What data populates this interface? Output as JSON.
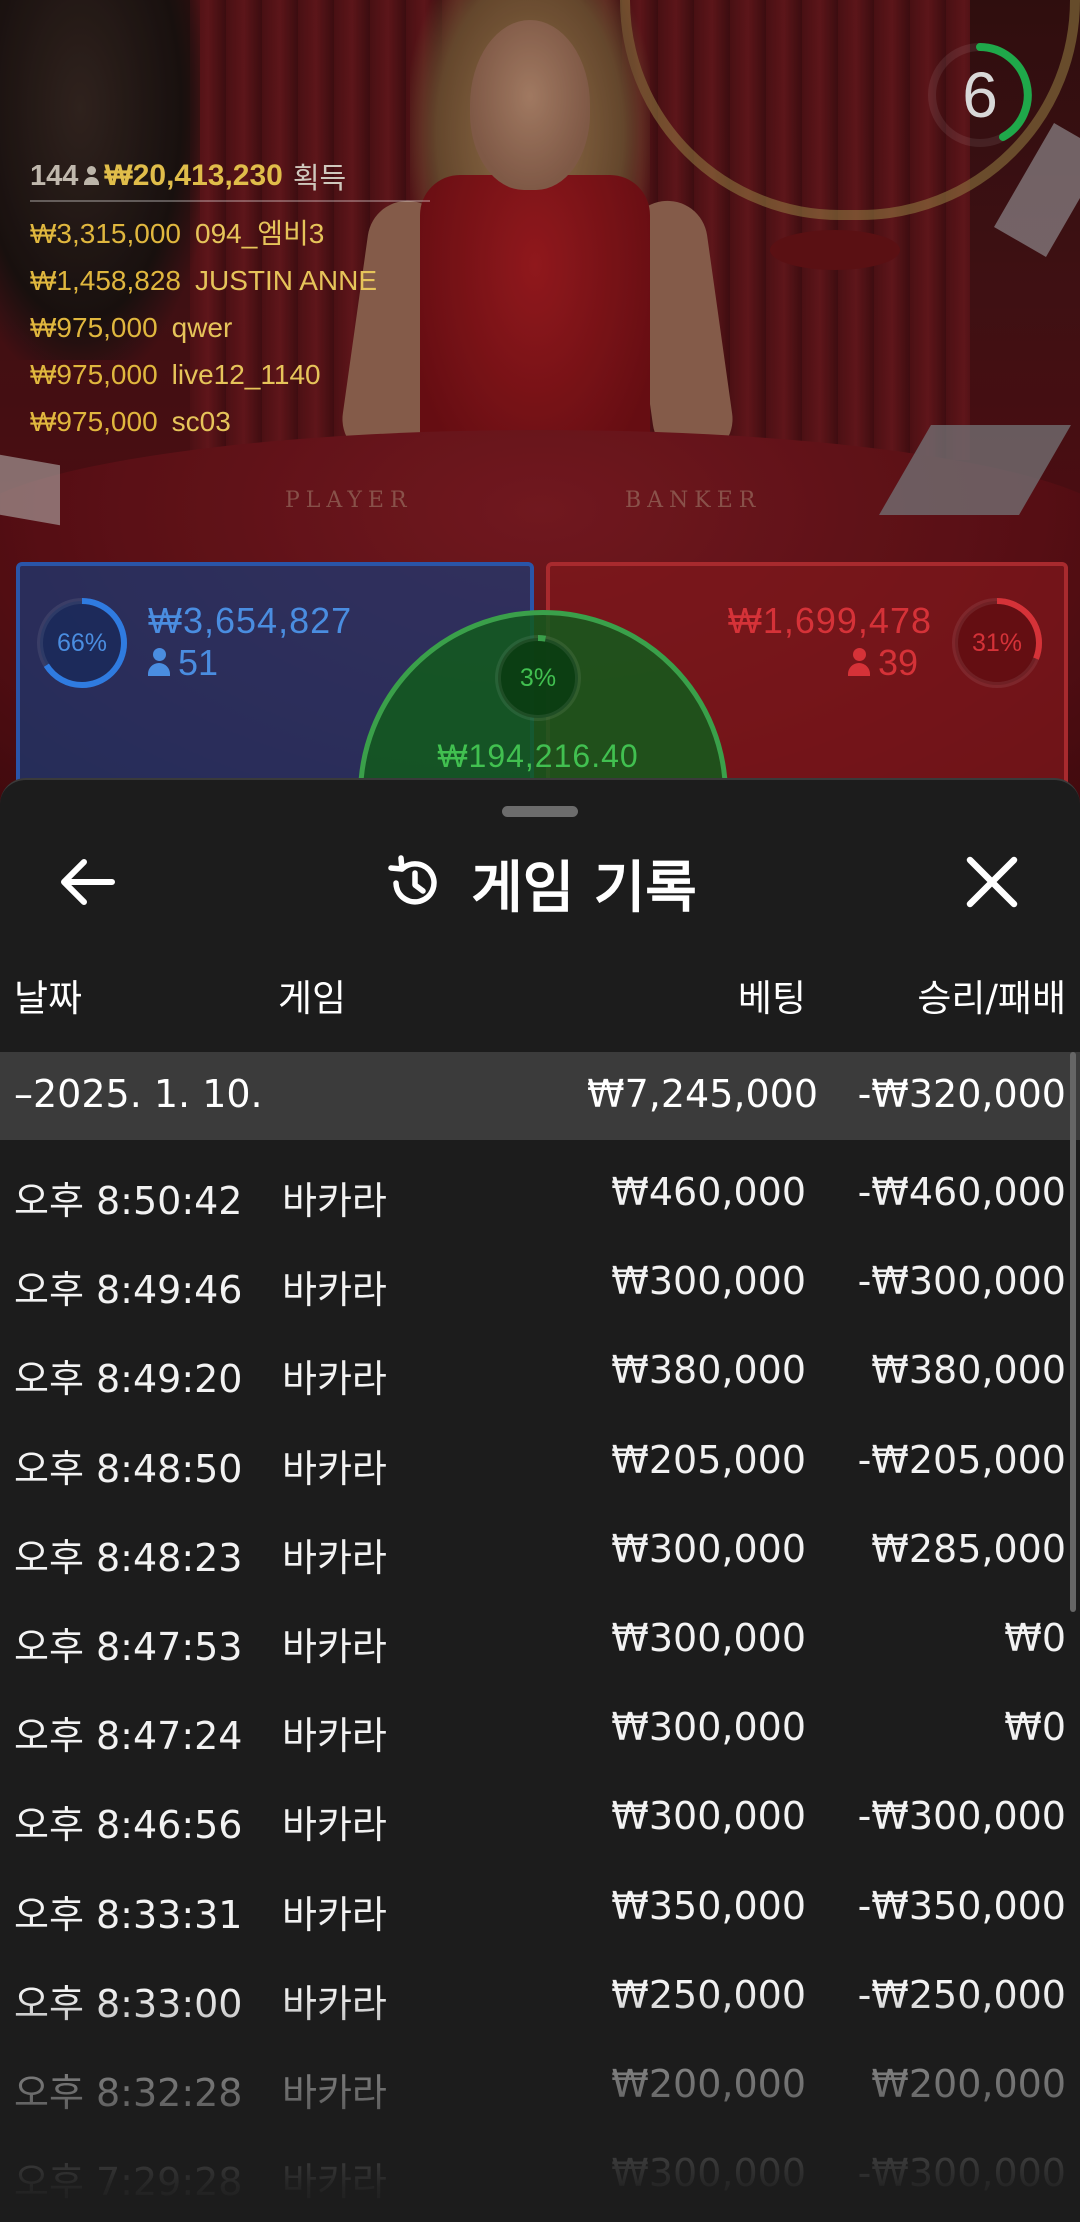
{
  "timer": {
    "value": "6"
  },
  "winners": {
    "count": "144",
    "total": "₩20,413,230",
    "suffix": "획득",
    "list": [
      {
        "amount": "₩3,315,000",
        "name": "094_엠비3"
      },
      {
        "amount": "₩1,458,828",
        "name": "JUSTIN ANNE"
      },
      {
        "amount": "₩975,000",
        "name": "qwer"
      },
      {
        "amount": "₩975,000",
        "name": "live12_1140"
      },
      {
        "amount": "₩975,000",
        "name": "sc03"
      }
    ]
  },
  "table": {
    "player_label": "PLAYER",
    "banker_label": "BANKER"
  },
  "betting": {
    "player": {
      "percent": "66%",
      "percent_value": 0.66,
      "amount": "₩3,654,827",
      "players": "51",
      "color": "#2f7be0"
    },
    "tie": {
      "percent": "3%",
      "percent_value": 0.03,
      "amount": "₩194,216.40",
      "color": "#3aa04a"
    },
    "banker": {
      "percent": "31%",
      "percent_value": 0.31,
      "amount": "₩1,699,478",
      "players": "39",
      "color": "#d53238"
    }
  },
  "sheet": {
    "title": "게임 기록",
    "icons": {
      "back": "arrow-left-icon",
      "history": "history-icon",
      "close": "close-icon"
    },
    "columns": {
      "date": "날짜",
      "game": "게임",
      "bet": "베팅",
      "winloss": "승리/패배"
    },
    "day": {
      "date": "–2025. 1. 10.",
      "bet": "₩7,245,000",
      "winloss": "-₩320,000"
    },
    "rows": [
      {
        "time": "오후 8:50:42",
        "game": "바카라",
        "bet": "₩460,000",
        "winloss": "-₩460,000"
      },
      {
        "time": "오후 8:49:46",
        "game": "바카라",
        "bet": "₩300,000",
        "winloss": "-₩300,000"
      },
      {
        "time": "오후 8:49:20",
        "game": "바카라",
        "bet": "₩380,000",
        "winloss": "₩380,000"
      },
      {
        "time": "오후 8:48:50",
        "game": "바카라",
        "bet": "₩205,000",
        "winloss": "-₩205,000"
      },
      {
        "time": "오후 8:48:23",
        "game": "바카라",
        "bet": "₩300,000",
        "winloss": "₩285,000"
      },
      {
        "time": "오후 8:47:53",
        "game": "바카라",
        "bet": "₩300,000",
        "winloss": "₩0"
      },
      {
        "time": "오후 8:47:24",
        "game": "바카라",
        "bet": "₩300,000",
        "winloss": "₩0"
      },
      {
        "time": "오후 8:46:56",
        "game": "바카라",
        "bet": "₩300,000",
        "winloss": "-₩300,000"
      },
      {
        "time": "오후 8:33:31",
        "game": "바카라",
        "bet": "₩350,000",
        "winloss": "-₩350,000"
      },
      {
        "time": "오후 8:33:00",
        "game": "바카라",
        "bet": "₩250,000",
        "winloss": "-₩250,000"
      },
      {
        "time": "오후 8:32:28",
        "game": "바카라",
        "bet": "₩200,000",
        "winloss": "₩200,000"
      },
      {
        "time": "오후 7:29:28",
        "game": "바카라",
        "bet": "₩300,000",
        "winloss": "-₩300,000"
      }
    ]
  }
}
